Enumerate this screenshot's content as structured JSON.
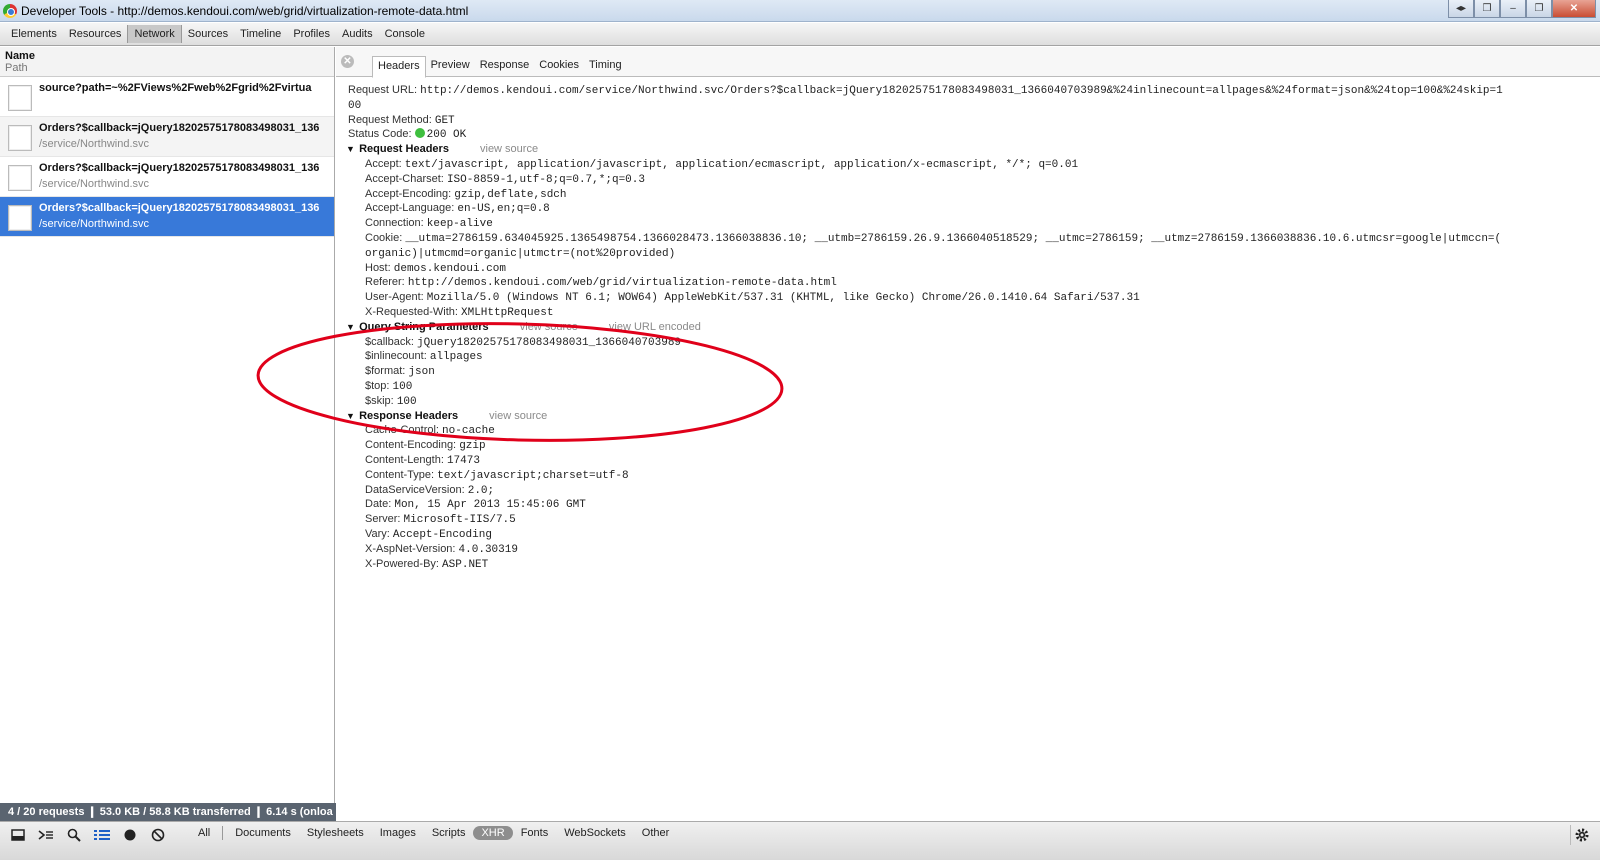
{
  "window": {
    "title": "Developer Tools - http://demos.kendoui.com/web/grid/virtualization-remote-data.html"
  },
  "panel_tabs": [
    "Elements",
    "Resources",
    "Network",
    "Sources",
    "Timeline",
    "Profiles",
    "Audits",
    "Console"
  ],
  "active_panel": "Network",
  "list_header": {
    "name": "Name",
    "path": "Path"
  },
  "requests": [
    {
      "name": "source?path=~%2FViews%2Fweb%2Fgrid%2Fvirtua",
      "path": ""
    },
    {
      "name": "Orders?$callback=jQuery18202575178083498031_136",
      "path": "/service/Northwind.svc"
    },
    {
      "name": "Orders?$callback=jQuery18202575178083498031_136",
      "path": "/service/Northwind.svc"
    },
    {
      "name": "Orders?$callback=jQuery18202575178083498031_136",
      "path": "/service/Northwind.svc"
    }
  ],
  "summary": "4 / 20 requests  ❙  53.0 KB / 58.8 KB transferred  ❙  6.14 s (onloa",
  "detail_tabs": [
    "Headers",
    "Preview",
    "Response",
    "Cookies",
    "Timing"
  ],
  "active_detail_tab": "Headers",
  "general": {
    "request_url_label": "Request URL:",
    "request_url_value": "http://demos.kendoui.com/service/Northwind.svc/Orders?$callback=jQuery18202575178083498031_1366040703989&%24inlinecount=allpages&%24format=json&%24top=100&%24skip=1",
    "request_url_wrap": "00",
    "method_label": "Request Method:",
    "method_value": "GET",
    "status_label": "Status Code:",
    "status_value": "200 OK"
  },
  "request_headers": {
    "title": "Request Headers",
    "view_source": "view source",
    "items": [
      {
        "k": "Accept:",
        "v": "text/javascript, application/javascript, application/ecmascript, application/x-ecmascript, */*; q=0.01"
      },
      {
        "k": "Accept-Charset:",
        "v": "ISO-8859-1,utf-8;q=0.7,*;q=0.3"
      },
      {
        "k": "Accept-Encoding:",
        "v": "gzip,deflate,sdch"
      },
      {
        "k": "Accept-Language:",
        "v": "en-US,en;q=0.8"
      },
      {
        "k": "Connection:",
        "v": "keep-alive"
      },
      {
        "k": "Cookie:",
        "v": "__utma=2786159.634045925.1365498754.1366028473.1366038836.10; __utmb=2786159.26.9.1366040518529; __utmc=2786159; __utmz=2786159.1366038836.10.6.utmcsr=google|utmccn=("
      },
      {
        "k": "",
        "v": "organic)|utmcmd=organic|utmctr=(not%20provided)"
      },
      {
        "k": "Host:",
        "v": "demos.kendoui.com"
      },
      {
        "k": "Referer:",
        "v": "http://demos.kendoui.com/web/grid/virtualization-remote-data.html"
      },
      {
        "k": "User-Agent:",
        "v": "Mozilla/5.0 (Windows NT 6.1; WOW64) AppleWebKit/537.31 (KHTML, like Gecko) Chrome/26.0.1410.64 Safari/537.31"
      },
      {
        "k": "X-Requested-With:",
        "v": "XMLHttpRequest"
      }
    ]
  },
  "query_params": {
    "title": "Query String Parameters",
    "view_source": "view source",
    "view_url_encoded": "view URL encoded",
    "items": [
      {
        "k": "$callback:",
        "v": "jQuery18202575178083498031_1366040703989"
      },
      {
        "k": "$inlinecount:",
        "v": "allpages"
      },
      {
        "k": "$format:",
        "v": "json"
      },
      {
        "k": "$top:",
        "v": "100"
      },
      {
        "k": "$skip:",
        "v": "100"
      }
    ]
  },
  "response_headers": {
    "title": "Response Headers",
    "view_source": "view source",
    "items": [
      {
        "k": "Cache-Control:",
        "v": "no-cache"
      },
      {
        "k": "Content-Encoding:",
        "v": "gzip"
      },
      {
        "k": "Content-Length:",
        "v": "17473"
      },
      {
        "k": "Content-Type:",
        "v": "text/javascript;charset=utf-8"
      },
      {
        "k": "DataServiceVersion:",
        "v": "2.0;"
      },
      {
        "k": "Date:",
        "v": "Mon, 15 Apr 2013 15:45:06 GMT"
      },
      {
        "k": "Server:",
        "v": "Microsoft-IIS/7.5"
      },
      {
        "k": "Vary:",
        "v": "Accept-Encoding"
      },
      {
        "k": "X-AspNet-Version:",
        "v": "4.0.30319"
      },
      {
        "k": "X-Powered-By:",
        "v": "ASP.NET"
      }
    ]
  },
  "filters": [
    "All",
    "Documents",
    "Stylesheets",
    "Images",
    "Scripts",
    "XHR",
    "Fonts",
    "WebSockets",
    "Other"
  ],
  "active_filter": "XHR",
  "colors": {
    "selected_row": "#3879d9",
    "annotation": "#e0001a",
    "status_ok": "#3fbf3f"
  }
}
